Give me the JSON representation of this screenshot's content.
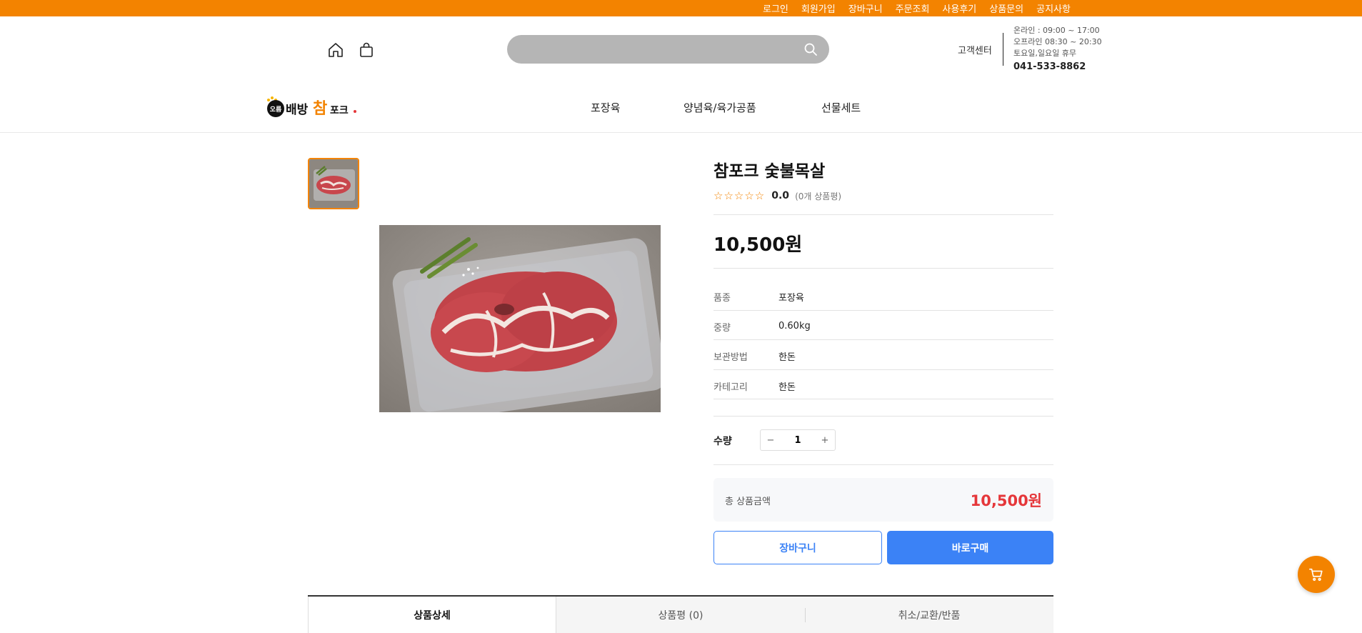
{
  "topbar": {
    "color": "#f38300",
    "links": [
      "로그인",
      "회원가입",
      "장바구니",
      "주문조회",
      "사용후기",
      "상품문의",
      "공지사항"
    ]
  },
  "header": {
    "search": {
      "placeholder": ""
    },
    "customer_center": {
      "label": "고객센터",
      "hours": [
        "온라인 : 09:00 ~ 17:00",
        "오프라인 08:30 ~ 20:30",
        "토요일,일요일 휴무"
      ],
      "phone": "041-533-8862"
    },
    "logo": {
      "small_text": "오름",
      "brand_text_1": "배방",
      "brand_text_2": "참",
      "brand_text_3": "포크"
    },
    "nav": [
      "포장육",
      "양념육/육가공품",
      "선물세트"
    ]
  },
  "product": {
    "title": "참포크 숯불목살",
    "rating": {
      "stars": "☆☆☆☆☆",
      "value": "0.0",
      "count_text": "(0개 상품평)"
    },
    "price": "10,500원",
    "specs": [
      {
        "label": "품종",
        "value": "포장육"
      },
      {
        "label": "중량",
        "value": "0.60kg"
      },
      {
        "label": "보관방법",
        "value": "한돈"
      },
      {
        "label": "카테고리",
        "value": "한돈"
      }
    ],
    "quantity": {
      "label": "수량",
      "minus": "−",
      "value": "1",
      "plus": "+"
    },
    "total": {
      "label": "총 상품금액",
      "value": "10,500원"
    },
    "buttons": {
      "cart": "장바구니",
      "buy": "바로구매"
    }
  },
  "tabs": [
    {
      "label": "상품상세",
      "active": true
    },
    {
      "label": "상품평 (0)",
      "active": false
    },
    {
      "label": "취소/교환/반품",
      "active": false
    }
  ],
  "colors": {
    "accent": "#f38300",
    "primary_button": "#3b82f6",
    "total_price": "#e5373a"
  },
  "icons": {
    "home": "home-icon",
    "bag": "shopping-bag-icon",
    "search": "search-icon",
    "cart": "cart-icon"
  }
}
